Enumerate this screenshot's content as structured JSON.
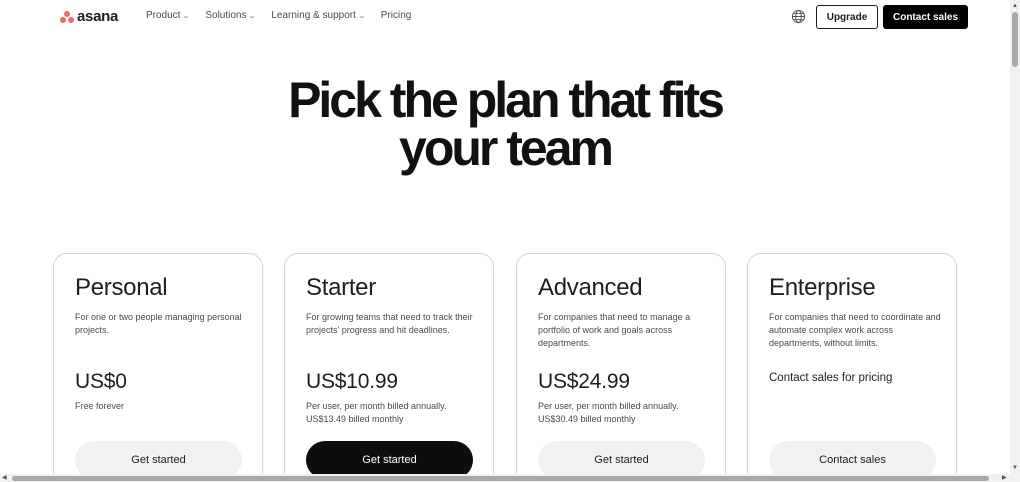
{
  "brand": {
    "name": "asana",
    "color": "#f06a6a"
  },
  "nav": {
    "items": [
      {
        "label": "Product",
        "has_dropdown": true
      },
      {
        "label": "Solutions",
        "has_dropdown": true
      },
      {
        "label": "Learning & support",
        "has_dropdown": true
      },
      {
        "label": "Pricing",
        "has_dropdown": false
      }
    ],
    "globe_icon": "globe-icon",
    "upgrade_label": "Upgrade",
    "contact_sales_label": "Contact sales"
  },
  "hero": {
    "line1": "Pick the plan that fits",
    "line2": "your team"
  },
  "plans": [
    {
      "name": "Personal",
      "description": "For one or two people managing personal projects.",
      "price": "US$0",
      "note": "Free forever",
      "button": "Get started"
    },
    {
      "name": "Starter",
      "description": "For growing teams that need to track their projects' progress and hit deadlines.",
      "price": "US$10.99",
      "note": "Per user, per month billed annually. US$13.49 billed monthly",
      "button": "Get started"
    },
    {
      "name": "Advanced",
      "description": "For companies that need to manage a portfolio of work and goals across departments.",
      "price": "US$24.99",
      "note": "Per user, per month billed annually. US$30.49 billed monthly",
      "button": "Get started"
    },
    {
      "name": "Enterprise",
      "description": "For companies that need to coordinate and automate complex work across departments, without limits.",
      "contact_text": "Contact sales for pricing",
      "button": "Contact sales"
    }
  ],
  "colors": {
    "primary_button": "#0d0d0d",
    "secondary_button": "#f1f1f1",
    "card_border": "#d5d5d7"
  }
}
